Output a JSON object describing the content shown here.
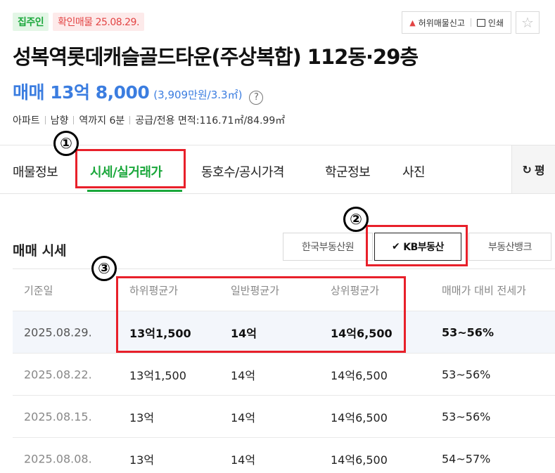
{
  "badges": {
    "owner": "집주인",
    "verified": "확인매물 25.08.29."
  },
  "top_actions": {
    "report": "허위매물신고",
    "print": "인쇄"
  },
  "title": "성복역롯데캐슬골드타운(주상복합) 112동·29층",
  "price": {
    "label": "매매 13억 8,000",
    "per_area": "(3,909만원/3.3㎡)",
    "help": "?"
  },
  "info": [
    "아파트",
    "남향",
    "역까지 6분",
    "공급/전용 면적:116.71㎡/84.99㎡"
  ],
  "tabs": [
    "매물정보",
    "시세/실거래가",
    "동호수/공시가격",
    "학군정보",
    "사진"
  ],
  "active_tab": "시세/실거래가",
  "refresh_label": "평",
  "section_title": "매매 시세",
  "sources": [
    {
      "label": "한국부동산원",
      "selected": false
    },
    {
      "label": "KB부동산",
      "selected": true
    },
    {
      "label": "부동산뱅크",
      "selected": false
    }
  ],
  "table": {
    "headers": [
      "기준일",
      "하위평균가",
      "일반평균가",
      "상위평균가",
      "매매가 대비 전세가"
    ],
    "rows": [
      [
        "2025.08.29.",
        "13억1,500",
        "14억",
        "14억6,500",
        "53~56%"
      ],
      [
        "2025.08.22.",
        "13억1,500",
        "14억",
        "14억6,500",
        "53~56%"
      ],
      [
        "2025.08.15.",
        "13억",
        "14억",
        "14억6,500",
        "53~56%"
      ],
      [
        "2025.08.08.",
        "13억",
        "14억",
        "14억6,500",
        "54~57%"
      ]
    ]
  },
  "annotations": [
    "①",
    "②",
    "③"
  ],
  "colors": {
    "brand_green": "#1aa73b",
    "price_blue": "#3b7de0",
    "annotation_red": "#e8202a"
  }
}
